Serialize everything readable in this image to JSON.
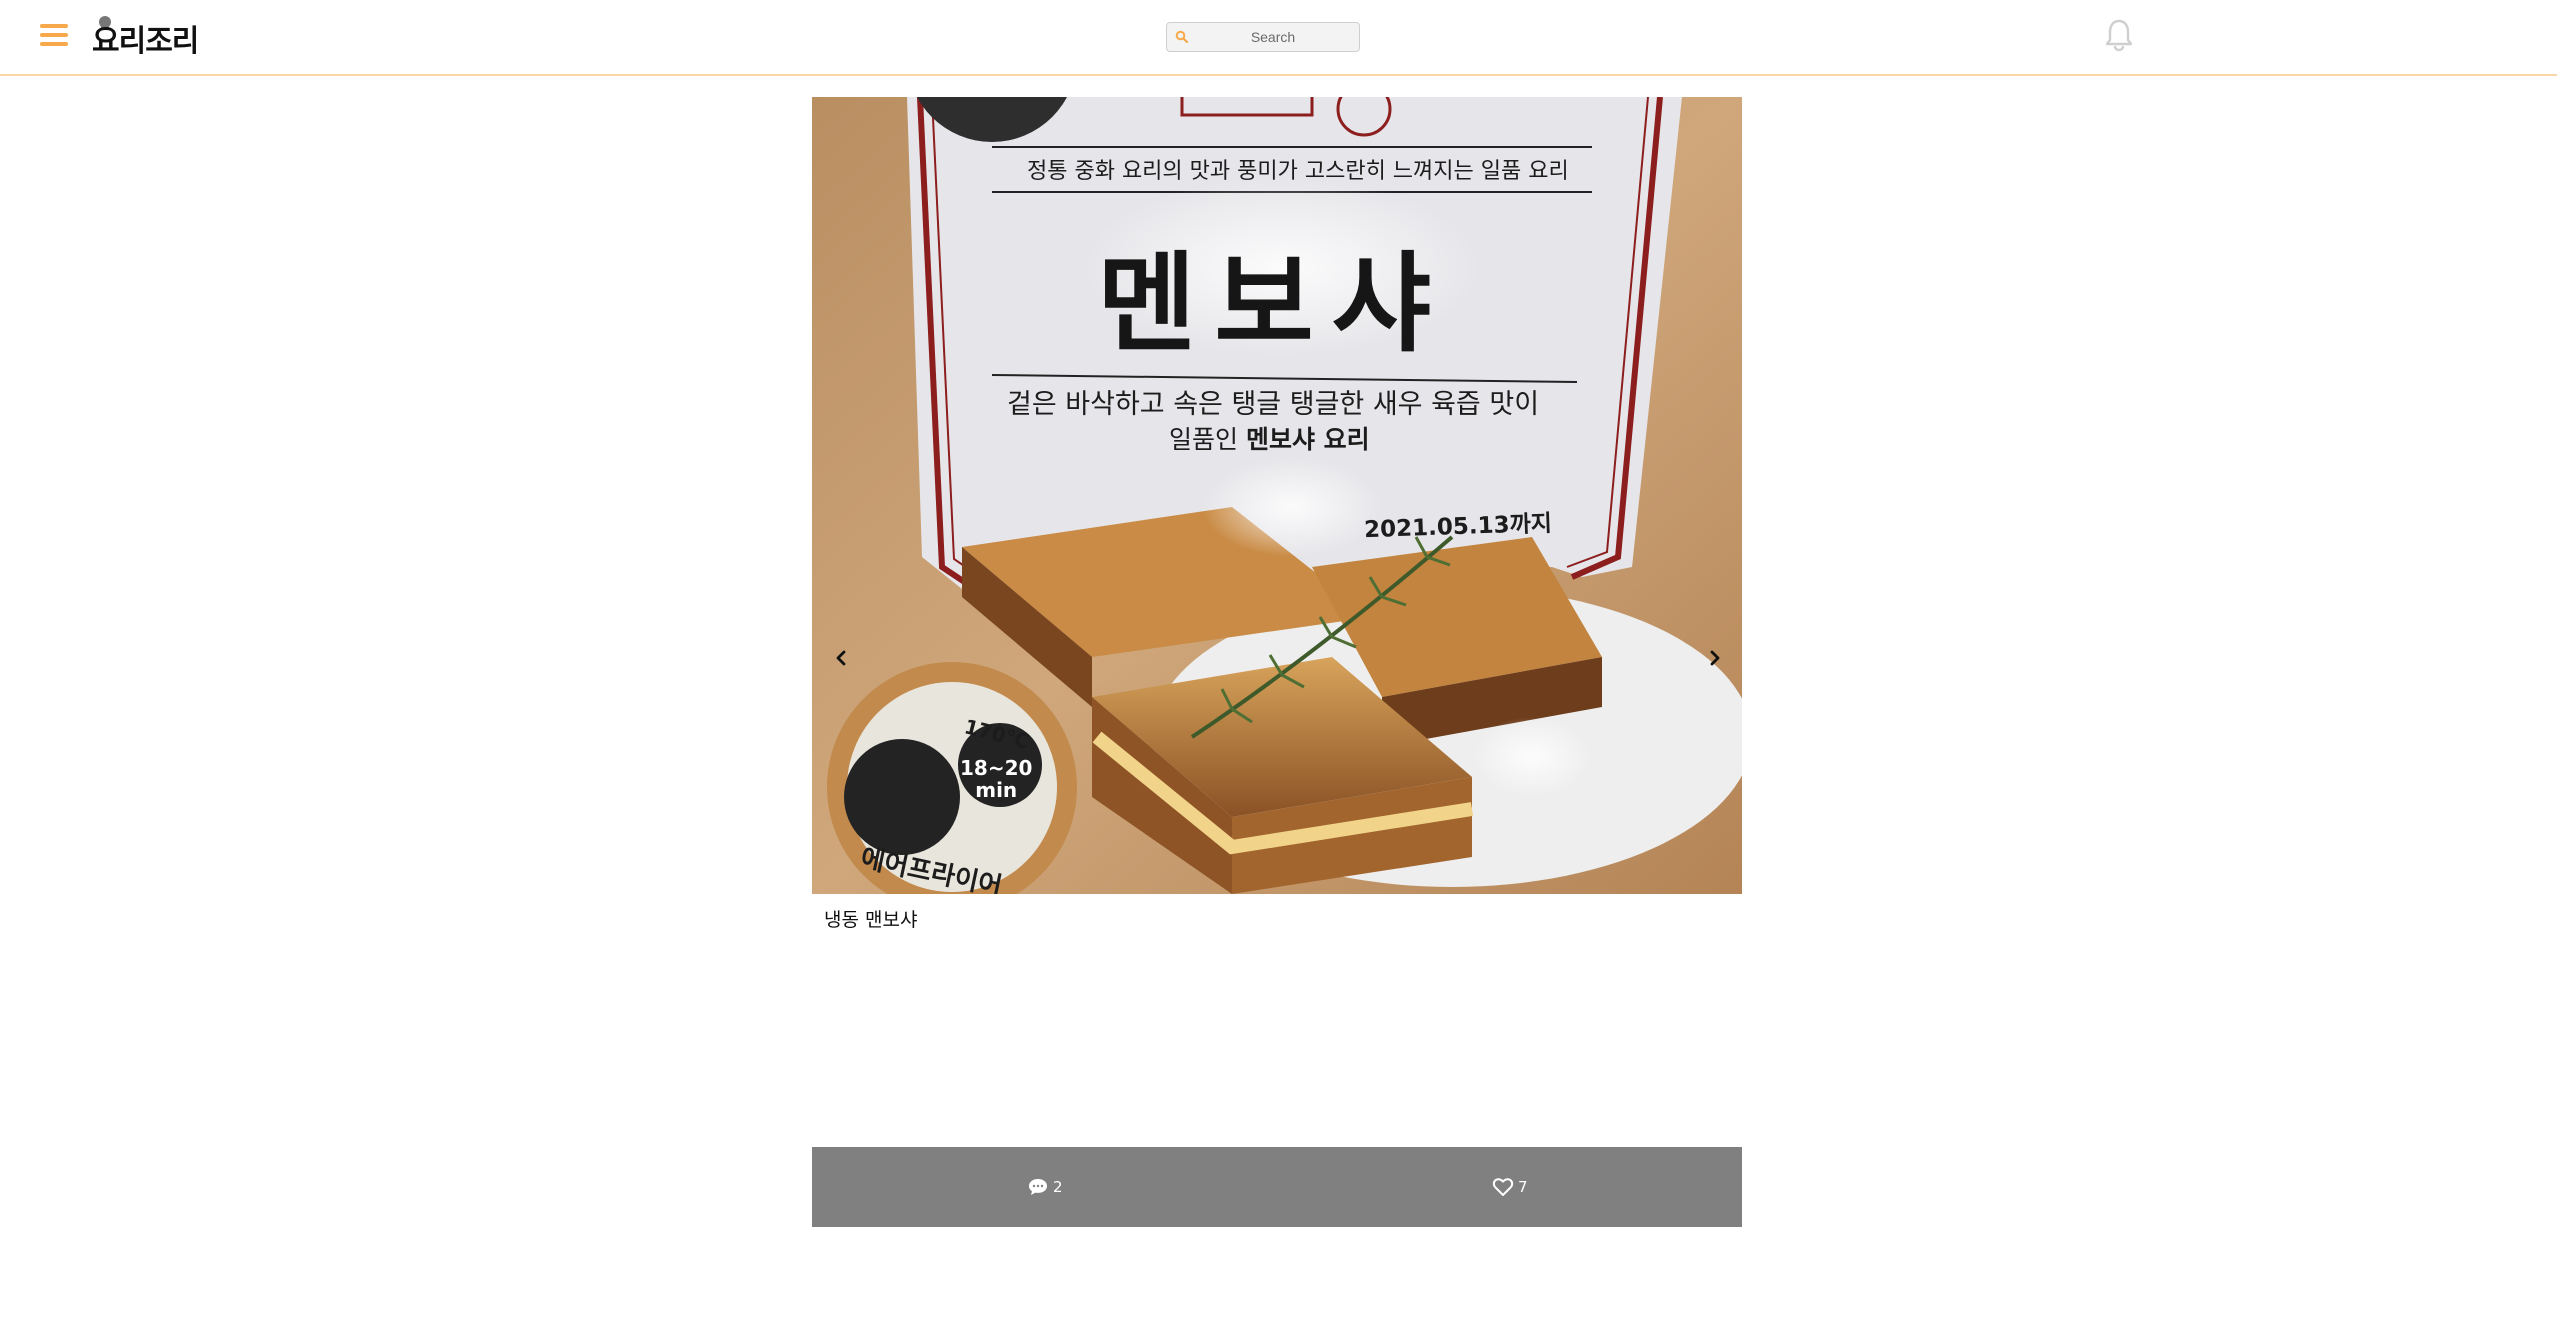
{
  "header": {
    "logo_text": "요리조리",
    "search_placeholder": "Search",
    "menu_icon": "hamburger-menu-icon",
    "notification_icon": "bell-icon",
    "accent_color": "#f7a94c"
  },
  "post": {
    "photo": {
      "tagline": "정통 중화 요리의 맛과 풍미가 고스란히 느껴지는 일품 요리",
      "product_name": "멘보샤",
      "description_line1": "겉은 바삭하고 속은 탱글 탱글한 새우 육즙 맛이",
      "description_line2_prefix": "일품인 ",
      "description_line2_bold": "멘보샤 요리",
      "expiry": "2021.05.13까지",
      "badge_temp": "170℃",
      "badge_time": "18~20\nmin",
      "badge_label": "에어프라이어"
    },
    "prev_icon": "chevron-left-icon",
    "next_icon": "chevron-right-icon",
    "caption": "냉동 맨보샤",
    "comments_count": "2",
    "likes_count": "7",
    "action_bar_color": "#808080"
  }
}
